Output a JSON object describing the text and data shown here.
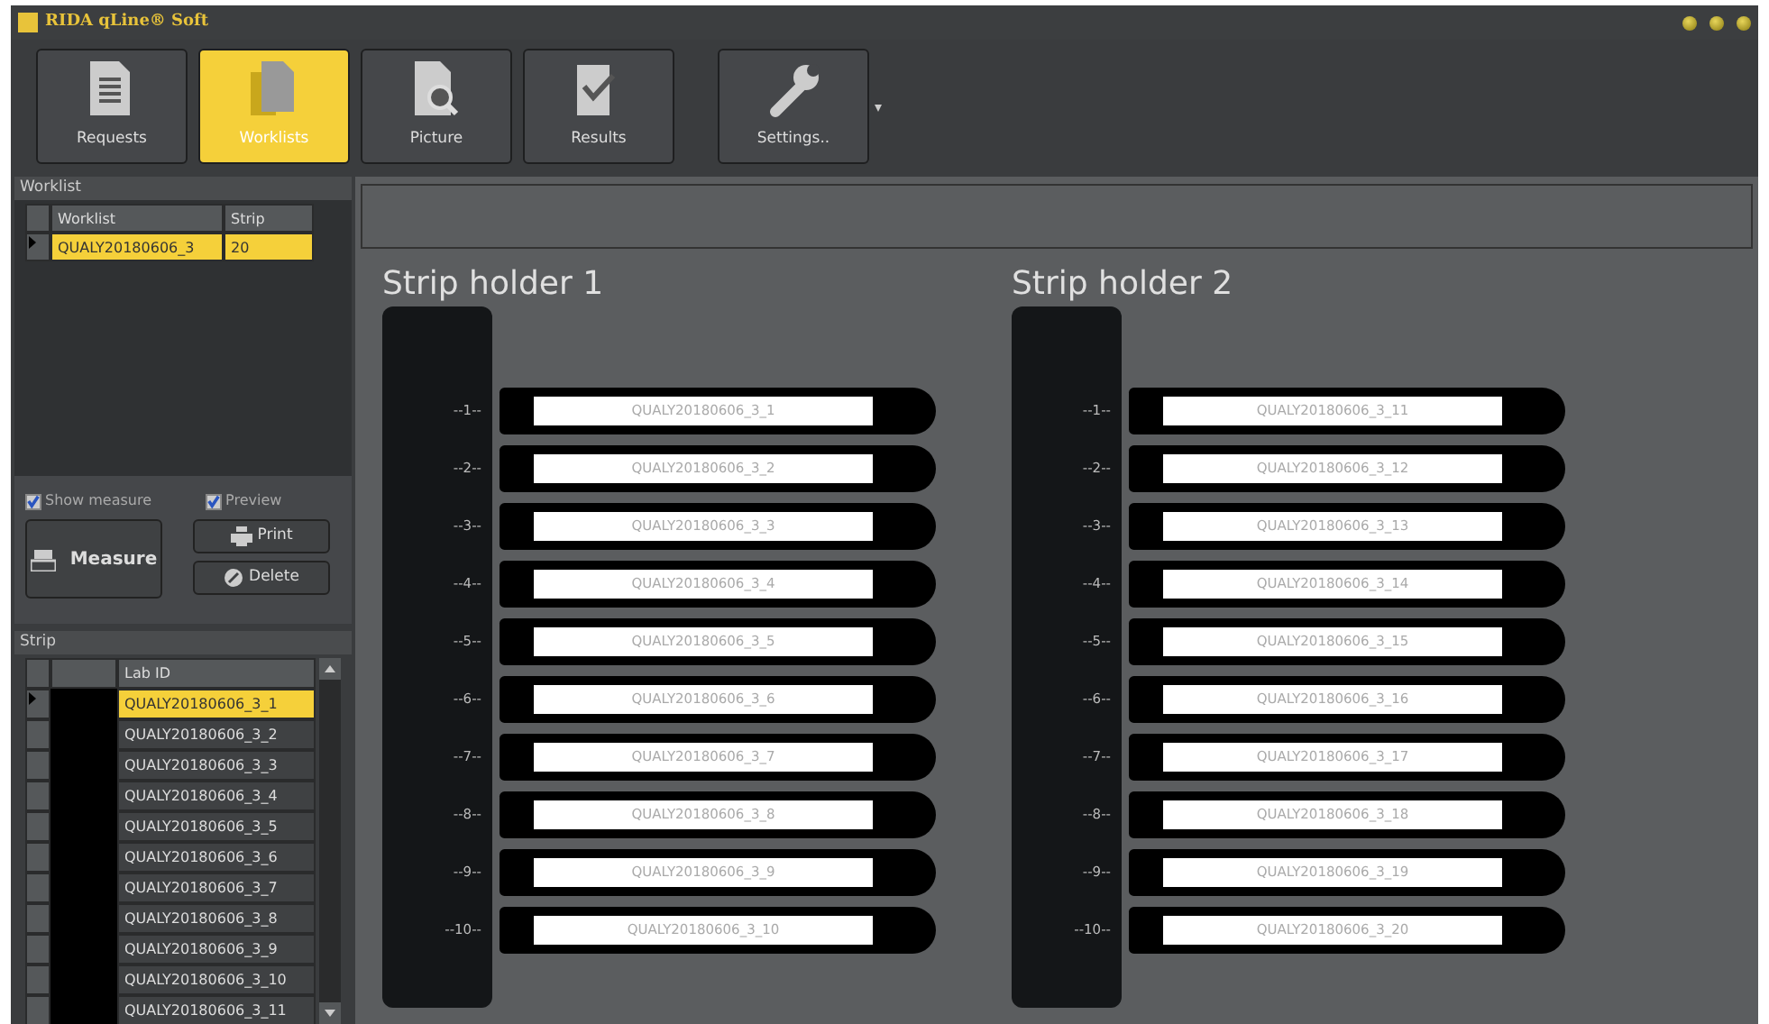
{
  "window": {
    "title": "RIDA qLine® Soft"
  },
  "toolbar": [
    {
      "label": "Requests",
      "kind": "document",
      "selected": false,
      "menu": false
    },
    {
      "label": "Worklists",
      "kind": "stack",
      "selected": true,
      "menu": false
    },
    {
      "label": "Picture",
      "kind": "magnifier",
      "selected": false,
      "menu": false
    },
    {
      "label": "Results",
      "kind": "check",
      "selected": false,
      "menu": false
    },
    {
      "label": "Settings..",
      "kind": "wrench",
      "selected": false,
      "menu": true
    }
  ],
  "worklist_panel": {
    "title": "Worklist",
    "columns": [
      "Worklist",
      "Strip"
    ],
    "rows": [
      {
        "cells": [
          "QUALY20180606_3",
          "20"
        ],
        "selected": true
      }
    ]
  },
  "options": [
    {
      "label": "Show measure",
      "checked": true
    },
    {
      "label": "Preview",
      "checked": true
    }
  ],
  "actions": [
    {
      "label": "Measure",
      "kind": "measure"
    },
    {
      "label": "Print",
      "kind": "print"
    },
    {
      "label": "Delete",
      "kind": "delete"
    }
  ],
  "strip_panel": {
    "title": "Strip",
    "column": "Lab ID",
    "rows": [
      {
        "lab_id": "QUALY20180606_3_1",
        "selected": true
      },
      {
        "lab_id": "QUALY20180606_3_2",
        "selected": false
      },
      {
        "lab_id": "QUALY20180606_3_3",
        "selected": false
      },
      {
        "lab_id": "QUALY20180606_3_4",
        "selected": false
      },
      {
        "lab_id": "QUALY20180606_3_5",
        "selected": false
      },
      {
        "lab_id": "QUALY20180606_3_6",
        "selected": false
      },
      {
        "lab_id": "QUALY20180606_3_7",
        "selected": false
      },
      {
        "lab_id": "QUALY20180606_3_8",
        "selected": false
      },
      {
        "lab_id": "QUALY20180606_3_9",
        "selected": false
      },
      {
        "lab_id": "QUALY20180606_3_10",
        "selected": false
      },
      {
        "lab_id": "QUALY20180606_3_11",
        "selected": false
      }
    ]
  },
  "holders": [
    {
      "title": "Strip holder 1",
      "slots": [
        {
          "number": "--1--",
          "label": "QUALY20180606_3_1"
        },
        {
          "number": "--2--",
          "label": "QUALY20180606_3_2"
        },
        {
          "number": "--3--",
          "label": "QUALY20180606_3_3"
        },
        {
          "number": "--4--",
          "label": "QUALY20180606_3_4"
        },
        {
          "number": "--5--",
          "label": "QUALY20180606_3_5"
        },
        {
          "number": "--6--",
          "label": "QUALY20180606_3_6"
        },
        {
          "number": "--7--",
          "label": "QUALY20180606_3_7"
        },
        {
          "number": "--8--",
          "label": "QUALY20180606_3_8"
        },
        {
          "number": "--9--",
          "label": "QUALY20180606_3_9"
        },
        {
          "number": "--10--",
          "label": "QUALY20180606_3_10"
        }
      ]
    },
    {
      "title": "Strip holder 2",
      "slots": [
        {
          "number": "--1--",
          "label": "QUALY20180606_3_11"
        },
        {
          "number": "--2--",
          "label": "QUALY20180606_3_12"
        },
        {
          "number": "--3--",
          "label": "QUALY20180606_3_13"
        },
        {
          "number": "--4--",
          "label": "QUALY20180606_3_14"
        },
        {
          "number": "--5--",
          "label": "QUALY20180606_3_15"
        },
        {
          "number": "--6--",
          "label": "QUALY20180606_3_16"
        },
        {
          "number": "--7--",
          "label": "QUALY20180606_3_17"
        },
        {
          "number": "--8--",
          "label": "QUALY20180606_3_18"
        },
        {
          "number": "--9--",
          "label": "QUALY20180606_3_19"
        },
        {
          "number": "--10--",
          "label": "QUALY20180606_3_20"
        }
      ]
    }
  ]
}
